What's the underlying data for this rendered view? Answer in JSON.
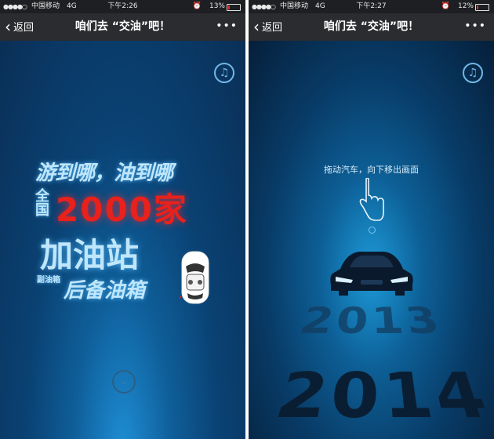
{
  "left": {
    "status": {
      "signal": "●●●●○",
      "carrier": "中国移动",
      "network": "4G",
      "time": "下午2:26",
      "battery": "13%",
      "battery_level": 0.13
    },
    "nav": {
      "back": "返回",
      "title": "咱们去 “交油”吧！",
      "more": "•••"
    },
    "poster": {
      "line1": "游到哪，油到哪",
      "quanguo": "全国",
      "big_number": "2000家",
      "line3": "加油站",
      "small_stack": "副油箱",
      "line4": "后备油箱"
    }
  },
  "right": {
    "status": {
      "signal": "●●●●○",
      "carrier": "中国移动",
      "network": "4G",
      "time": "下午2:27",
      "battery": "12%",
      "battery_level": 0.12
    },
    "nav": {
      "back": "返回",
      "title": "咱们去 “交油”吧！",
      "more": "•••"
    },
    "hint": "拖动汽车，向下移出画面",
    "years": {
      "back": "2013",
      "front": "2014"
    }
  },
  "icons": {
    "music": "♫",
    "scroll_down": "⌄",
    "back": "‹"
  },
  "colors": {
    "accent_red": "#e8211c",
    "glow_blue": "#bfe6fb",
    "statusbar": "#1e1f22",
    "navbar": "#2b2c2f"
  }
}
